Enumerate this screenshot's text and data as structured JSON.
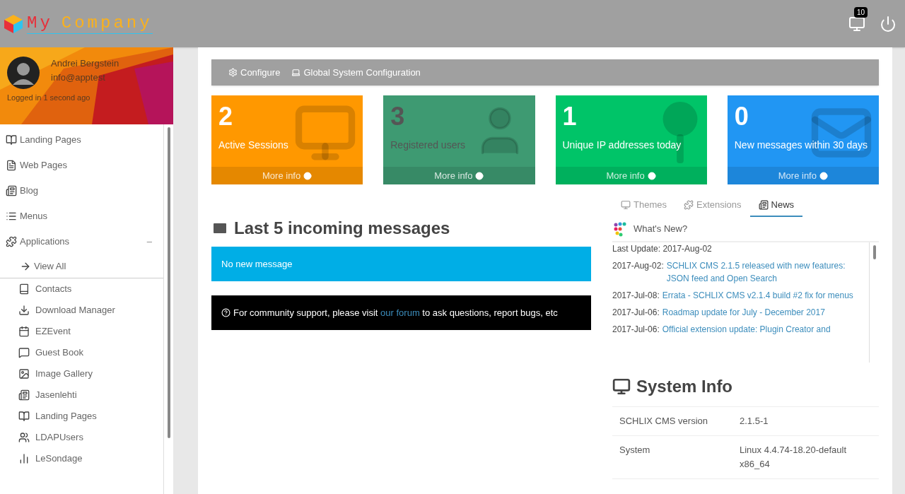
{
  "header": {
    "logo": {
      "first": "My",
      "second": "Company"
    },
    "notifications_badge": "10"
  },
  "profile": {
    "name": "Andrei Bergstein",
    "email": "info@apptest",
    "status": "Logged in 1 second ago"
  },
  "sidebar": {
    "items": [
      {
        "label": "Landing Pages"
      },
      {
        "label": "Web Pages"
      },
      {
        "label": "Blog"
      },
      {
        "label": "Menus"
      },
      {
        "label": "Applications",
        "expanded": true,
        "toggle": "–",
        "children": [
          {
            "label": "View All"
          },
          {
            "label": "Contacts"
          },
          {
            "label": "Download Manager"
          },
          {
            "label": "EZEvent"
          },
          {
            "label": "Guest Book"
          },
          {
            "label": "Image Gallery"
          },
          {
            "label": "Jasenlehti"
          },
          {
            "label": "Landing Pages"
          },
          {
            "label": "LDAPUsers"
          },
          {
            "label": "LeSondage"
          }
        ]
      }
    ]
  },
  "toolbar": [
    "Configure",
    "Global System Configuration"
  ],
  "stats": [
    {
      "value": "2",
      "label": "Active Sessions",
      "link": "More info",
      "color": "#ff9800"
    },
    {
      "value": "3",
      "label": "Registered users",
      "link": "More info",
      "color": "#3e9a72"
    },
    {
      "value": "1",
      "label": "Unique IP addresses today",
      "link": "More info",
      "color": "#00c468"
    },
    {
      "value": "0",
      "label": "New messages within 30 days",
      "link": "More info",
      "color": "#2196f3"
    }
  ],
  "messages": {
    "title": "Last 5 incoming messages",
    "empty": "No new message"
  },
  "community": {
    "before": "For community support, please visit",
    "link": "our forum",
    "after": "to ask questions, report bugs, etc"
  },
  "tabs": [
    {
      "label": "Themes",
      "selected": false
    },
    {
      "label": "Extensions",
      "selected": false
    },
    {
      "label": "News",
      "selected": true
    }
  ],
  "news": {
    "title": "What's New?",
    "last_update": "Last Update: 2017-Aug-02",
    "items": [
      {
        "date": "2017-Aug-02:",
        "title": "SCHLIX CMS 2.1.5 released with new features: JSON feed and Open Search"
      },
      {
        "date": "2017-Jul-08:",
        "title": "Errata - SCHLIX CMS v2.1.4 build #2 fix for menus"
      },
      {
        "date": "2017-Jul-06:",
        "title": "Roadmap update for July - December 2017"
      },
      {
        "date": "2017-Jul-06:",
        "title": "Official extension update: Plugin Creator and"
      }
    ]
  },
  "system_info": {
    "title": "System Info",
    "rows": [
      {
        "name": "SCHLIX CMS version",
        "value": "2.1.5-1"
      },
      {
        "name": "System",
        "value": "Linux 4.4.74-18.20-default x86_64"
      }
    ]
  }
}
